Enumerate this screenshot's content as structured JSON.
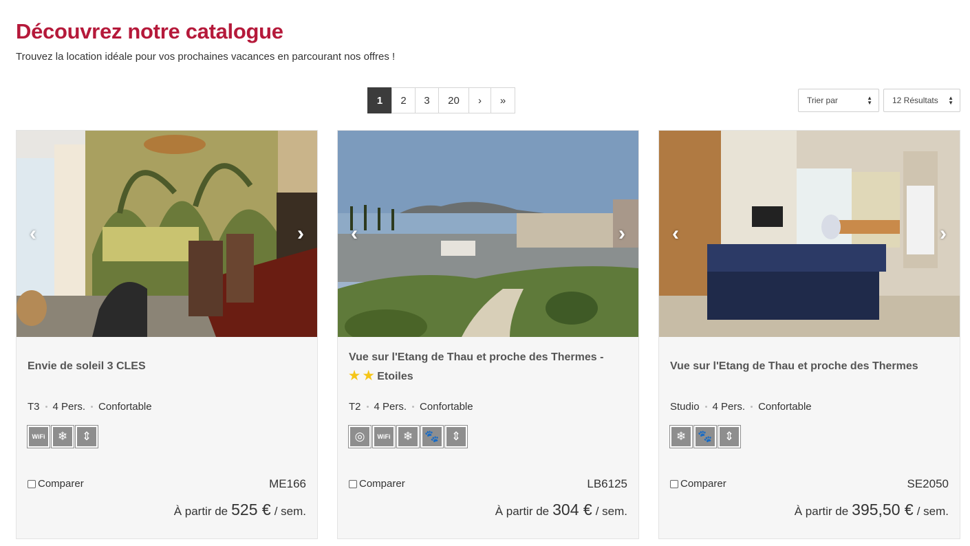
{
  "header": {
    "title": "Découvrez notre catalogue",
    "subtitle": "Trouvez la location idéale pour vos prochaines vacances en parcourant nos offres !"
  },
  "pagination": {
    "pages": [
      "1",
      "2",
      "3",
      "20"
    ],
    "current": "1",
    "next": "›",
    "last": "»"
  },
  "controls": {
    "sort_label": "Trier par",
    "results_label": "12 Résultats"
  },
  "listings": [
    {
      "title": "Envie de soleil 3 CLES",
      "type": "T3",
      "persons": "4 Pers.",
      "comfort": "Confortable",
      "amenities": [
        "wifi-icon",
        "air-conditioning-icon",
        "elevator-icon"
      ],
      "compare_label": "Comparer",
      "reference": "ME166",
      "price_prefix": "À partir de",
      "price": "525 €",
      "price_suffix": "/ sem."
    },
    {
      "title": "Vue sur l'Etang de Thau et proche des Thermes -",
      "stars": 2,
      "title_suffix": "Etoiles",
      "type": "T2",
      "persons": "4 Pers.",
      "comfort": "Confortable",
      "amenities": [
        "washing-machine-icon",
        "wifi-icon",
        "air-conditioning-icon",
        "pets-allowed-icon",
        "elevator-icon"
      ],
      "compare_label": "Comparer",
      "reference": "LB6125",
      "price_prefix": "À partir de",
      "price": "304 €",
      "price_suffix": "/ sem."
    },
    {
      "title": "Vue sur l'Etang de Thau et proche des Thermes",
      "type": "Studio",
      "persons": "4 Pers.",
      "comfort": "Confortable",
      "amenities": [
        "air-conditioning-icon",
        "pets-allowed-icon",
        "elevator-icon"
      ],
      "compare_label": "Comparer",
      "reference": "SE2050",
      "price_prefix": "À partir de",
      "price": "395,50 €",
      "price_suffix": "/ sem."
    }
  ],
  "colors": {
    "title": "#b5193a",
    "card_background": "#f6f6f6",
    "active_page": "#3c3c3c",
    "amenity_icon": "#8e8e8e",
    "star": "#f5c518"
  }
}
